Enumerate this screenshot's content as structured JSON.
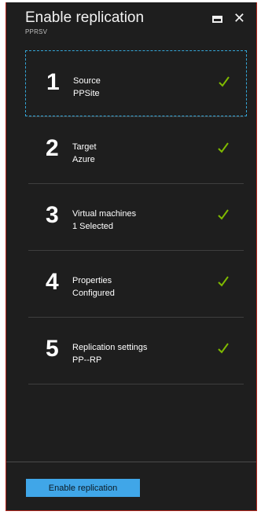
{
  "header": {
    "title": "Enable replication",
    "subtitle": "PPRSV"
  },
  "steps": [
    {
      "number": "1",
      "label": "Source",
      "value": "PPSite",
      "complete": true
    },
    {
      "number": "2",
      "label": "Target",
      "value": "Azure",
      "complete": true
    },
    {
      "number": "3",
      "label": "Virtual machines",
      "value": "1 Selected",
      "complete": true
    },
    {
      "number": "4",
      "label": "Properties",
      "value": "Configured",
      "complete": true
    },
    {
      "number": "5",
      "label": "Replication settings",
      "value": "PP--RP",
      "complete": true
    }
  ],
  "footer": {
    "button_label": "Enable replication"
  },
  "colors": {
    "background": "#1e1e1e",
    "check": "#7fba00",
    "selected_border": "#35a7d8",
    "button": "#40a6e8",
    "blade_border": "#b0251c"
  },
  "icons": {
    "maximize": "maximize-icon",
    "close": "close-icon",
    "check": "checkmark-icon"
  }
}
